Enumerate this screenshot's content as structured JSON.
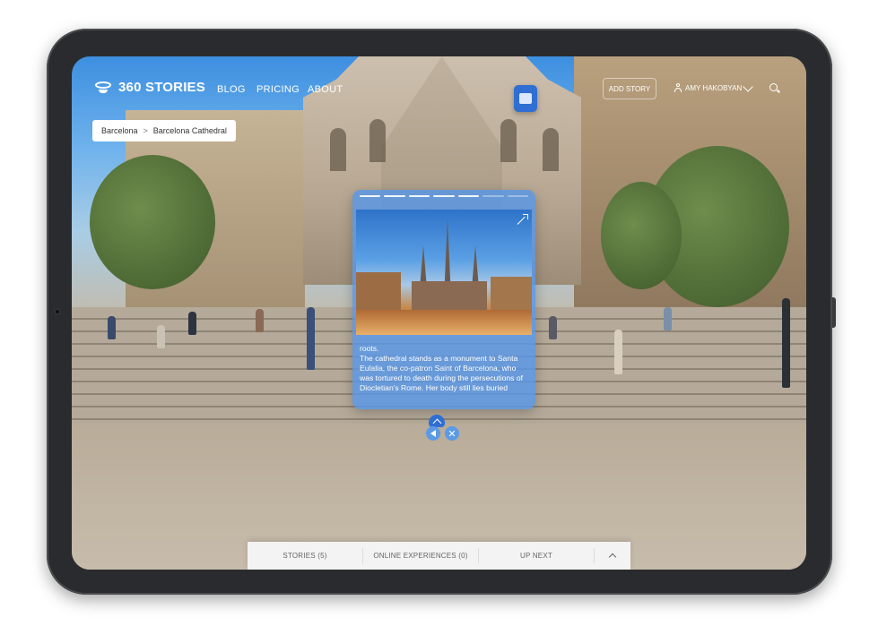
{
  "app": {
    "name": "360 STORIES"
  },
  "nav": {
    "links": [
      "BLOG",
      "PRICING",
      "ABOUT"
    ],
    "add_story_label": "ADD STORY",
    "user_name": "AMY HAKOBYAN"
  },
  "breadcrumb": {
    "items": [
      "Barcelona",
      "Barcelona Cathedral"
    ],
    "separator": ">"
  },
  "story": {
    "progress": {
      "total_segments": 7,
      "completed_segments": 5
    },
    "text_lines": [
      "roots.",
      "The cathedral stands as a monument to Santa",
      "Eulalia, the co-patron Saint of Barcelona, who",
      "was tortured to death during the persecutions of",
      "Diocletian's Rome. Her body still lies buried"
    ]
  },
  "controls": {
    "close_symbol": "✕"
  },
  "bottom_bar": {
    "tabs": [
      "STORIES (5)",
      "ONLINE EXPERIENCES (0)",
      "UP NEXT"
    ]
  },
  "colors": {
    "accent": "#2f6fd3",
    "card": "#5896e6"
  }
}
